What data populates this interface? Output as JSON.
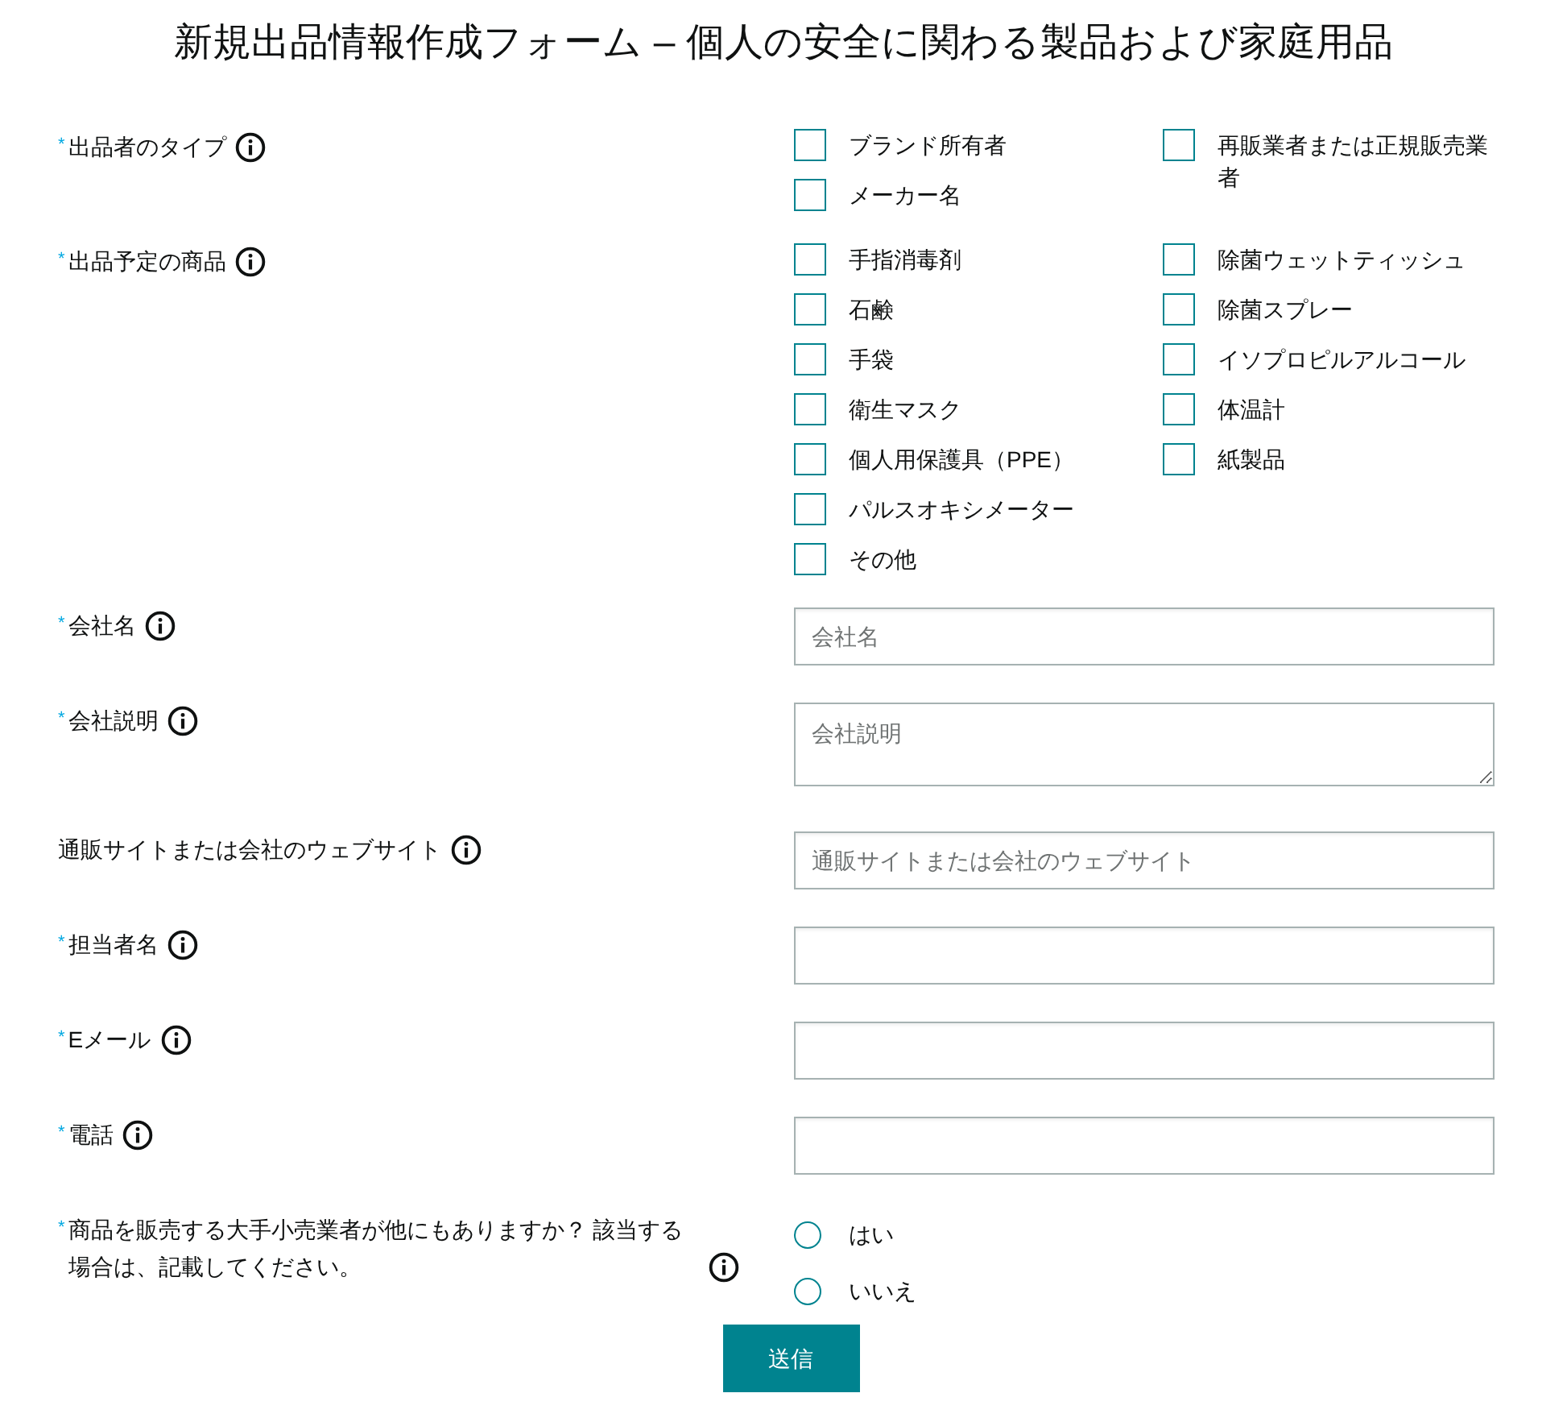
{
  "title": "新規出品情報作成フォーム – 個人の安全に関わる製品および家庭用品",
  "fields": [
    {
      "kind": "checkboxes",
      "required_mark": "*",
      "label": "出品者のタイプ",
      "columns": [
        [
          {
            "label": "ブランド所有者",
            "checked": false
          },
          {
            "label": "メーカー名",
            "checked": false
          }
        ],
        [
          {
            "label": "再販業者または正規販売業者",
            "checked": false
          }
        ]
      ]
    },
    {
      "kind": "checkboxes",
      "required_mark": "*",
      "label": "出品予定の商品",
      "columns": [
        [
          {
            "label": "手指消毒剤",
            "checked": false
          },
          {
            "label": "石鹸",
            "checked": false
          },
          {
            "label": "手袋",
            "checked": false
          },
          {
            "label": "衛生マスク",
            "checked": false
          },
          {
            "label": "個人用保護具（PPE）",
            "checked": false
          },
          {
            "label": "パルスオキシメーター",
            "checked": false
          },
          {
            "label": "その他",
            "checked": false
          }
        ],
        [
          {
            "label": "除菌ウェットティッシュ",
            "checked": false
          },
          {
            "label": "除菌スプレー",
            "checked": false
          },
          {
            "label": "イソプロピルアルコール",
            "checked": false
          },
          {
            "label": "体温計",
            "checked": false
          },
          {
            "label": "紙製品",
            "checked": false
          }
        ]
      ]
    },
    {
      "kind": "text",
      "required_mark": "*",
      "label": "会社名",
      "placeholder": "会社名"
    },
    {
      "kind": "textarea",
      "required_mark": "*",
      "label": "会社説明",
      "placeholder": "会社説明"
    },
    {
      "kind": "text",
      "label": "通販サイトまたは会社のウェブサイト",
      "placeholder": "通販サイトまたは会社のウェブサイト"
    },
    {
      "kind": "text",
      "required_mark": "*",
      "label": "担当者名"
    },
    {
      "kind": "text",
      "required_mark": "*",
      "label": "Eメール"
    },
    {
      "kind": "text",
      "required_mark": "*",
      "label": "電話"
    },
    {
      "kind": "radios",
      "required_mark": "*",
      "label": "商品を販売する大手小売業者が他にもありますか？ 該当する場合は、記載してください。",
      "options": [
        {
          "label": "はい",
          "selected": false
        },
        {
          "label": "いいえ",
          "selected": false
        }
      ]
    }
  ],
  "submit": "送信"
}
